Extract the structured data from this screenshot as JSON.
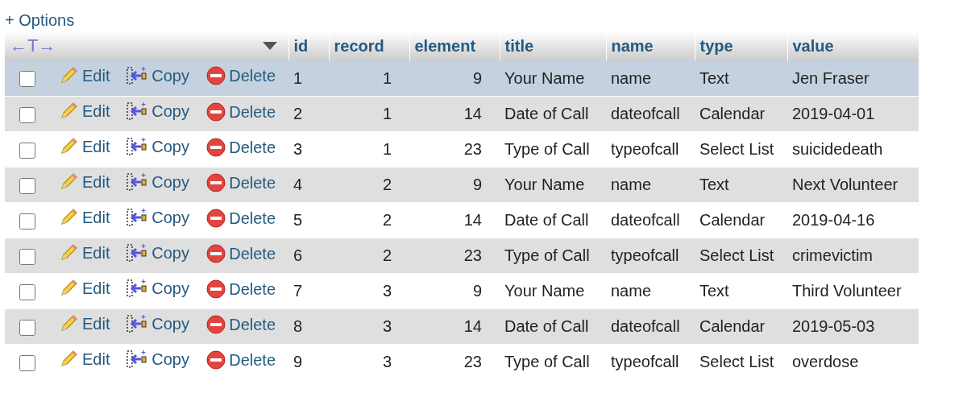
{
  "options_link": "+ Options",
  "header": {
    "arrows": "←T→",
    "columns": [
      "id",
      "record",
      "element",
      "title",
      "name",
      "type",
      "value"
    ]
  },
  "rows": [
    {
      "checked": false,
      "highlighted": true,
      "actions": [
        "Edit",
        "Copy",
        "Delete"
      ],
      "cells": [
        "1",
        "1",
        "9",
        "Your Name",
        "name",
        "Text",
        "Jen Fraser"
      ]
    },
    {
      "checked": false,
      "highlighted": false,
      "actions": [
        "Edit",
        "Copy",
        "Delete"
      ],
      "cells": [
        "2",
        "1",
        "14",
        "Date of Call",
        "dateofcall",
        "Calendar",
        "2019-04-01"
      ]
    },
    {
      "checked": false,
      "highlighted": false,
      "actions": [
        "Edit",
        "Copy",
        "Delete"
      ],
      "cells": [
        "3",
        "1",
        "23",
        "Type of Call",
        "typeofcall",
        "Select List",
        "suicidedeath"
      ]
    },
    {
      "checked": false,
      "highlighted": false,
      "actions": [
        "Edit",
        "Copy",
        "Delete"
      ],
      "cells": [
        "4",
        "2",
        "9",
        "Your Name",
        "name",
        "Text",
        "Next Volunteer"
      ]
    },
    {
      "checked": false,
      "highlighted": false,
      "actions": [
        "Edit",
        "Copy",
        "Delete"
      ],
      "cells": [
        "5",
        "2",
        "14",
        "Date of Call",
        "dateofcall",
        "Calendar",
        "2019-04-16"
      ]
    },
    {
      "checked": false,
      "highlighted": false,
      "actions": [
        "Edit",
        "Copy",
        "Delete"
      ],
      "cells": [
        "6",
        "2",
        "23",
        "Type of Call",
        "typeofcall",
        "Select List",
        "crimevictim"
      ]
    },
    {
      "checked": false,
      "highlighted": false,
      "actions": [
        "Edit",
        "Copy",
        "Delete"
      ],
      "cells": [
        "7",
        "3",
        "9",
        "Your Name",
        "name",
        "Text",
        "Third Volunteer"
      ]
    },
    {
      "checked": false,
      "highlighted": false,
      "actions": [
        "Edit",
        "Copy",
        "Delete"
      ],
      "cells": [
        "8",
        "3",
        "14",
        "Date of Call",
        "dateofcall",
        "Calendar",
        "2019-05-03"
      ]
    },
    {
      "checked": false,
      "highlighted": false,
      "actions": [
        "Edit",
        "Copy",
        "Delete"
      ],
      "cells": [
        "9",
        "3",
        "23",
        "Type of Call",
        "typeofcall",
        "Select List",
        "overdose"
      ]
    }
  ]
}
